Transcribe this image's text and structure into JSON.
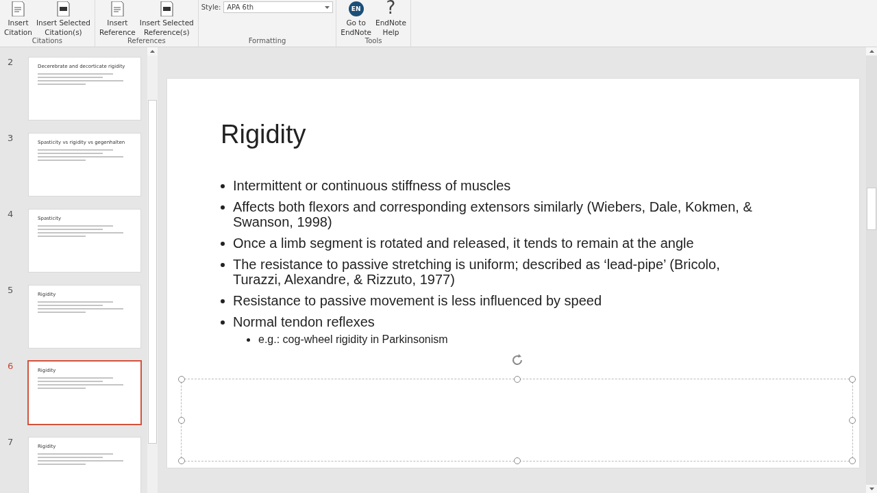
{
  "ribbon": {
    "groups": [
      {
        "label": "Citations",
        "kind": "buttons",
        "buttons": [
          {
            "label": "Insert Citation"
          },
          {
            "label": "Insert Selected Citation(s)"
          }
        ]
      },
      {
        "label": "References",
        "kind": "buttons",
        "buttons": [
          {
            "label": "Insert Reference"
          },
          {
            "label": "Insert Selected Reference(s)"
          }
        ]
      },
      {
        "label": "Formatting",
        "kind": "style",
        "style_label": "Style:",
        "style_value": "APA 6th"
      },
      {
        "label": "Tools",
        "kind": "buttons",
        "buttons": [
          {
            "label": "Go to EndNote",
            "badge": "EN"
          },
          {
            "label": "EndNote Help",
            "badge": "?"
          }
        ]
      }
    ]
  },
  "thumbnails": [
    {
      "number": "2",
      "selected": false,
      "title": "Decerebrate and decorticate rigidity"
    },
    {
      "number": "3",
      "selected": false,
      "title": "Spasticity vs rigidity vs gegenhalten"
    },
    {
      "number": "4",
      "selected": false,
      "title": "Spasticity"
    },
    {
      "number": "5",
      "selected": false,
      "title": "Rigidity"
    },
    {
      "number": "6",
      "selected": true,
      "title": "Rigidity"
    },
    {
      "number": "7",
      "selected": false,
      "title": "Rigidity"
    }
  ],
  "slide": {
    "title": "Rigidity",
    "bullets": [
      {
        "text": "Intermittent or continuous stiffness of muscles"
      },
      {
        "text": "Affects both flexors and corresponding extensors similarly (Wiebers, Dale, Kokmen, & Swanson, 1998)"
      },
      {
        "text": "Once a limb segment is rotated and released, it tends to remain at the angle"
      },
      {
        "text": "The resistance to passive stretching is uniform; described as ‘lead-pipe’ (Bricolo, Turazzi, Alexandre, & Rizzuto, 1977)"
      },
      {
        "text": "Resistance to passive movement is less influenced by speed"
      },
      {
        "text": "Normal tendon reflexes",
        "children": [
          {
            "text": "e.g.: cog-wheel rigidity in Parkinsonism"
          }
        ]
      }
    ],
    "placeholder_selected": true
  }
}
